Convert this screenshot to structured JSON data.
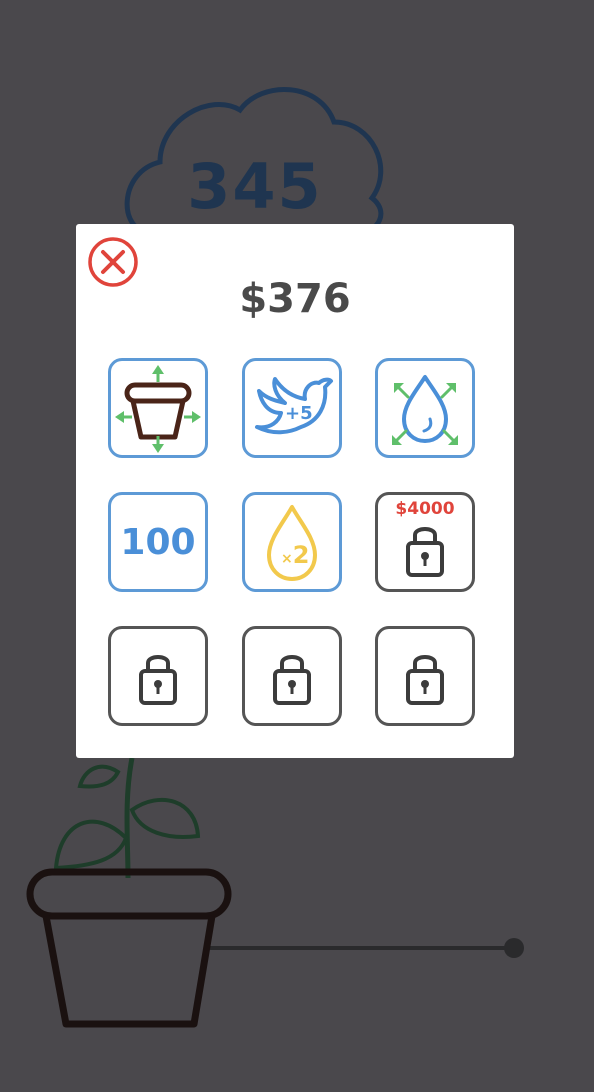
{
  "background": {
    "score": "345"
  },
  "shop": {
    "money": "$376",
    "tiles": [
      {
        "name": "pot-upgrade",
        "icon": "pot-expand-icon",
        "locked": false
      },
      {
        "name": "bird-bonus",
        "icon": "bird-icon",
        "label": "+5",
        "locked": false
      },
      {
        "name": "drop-upgrade",
        "icon": "drop-expand-icon",
        "locked": false
      },
      {
        "name": "hundred",
        "icon": "number-icon",
        "label": "100",
        "locked": false
      },
      {
        "name": "drop-x2",
        "icon": "drop-multiplier-icon",
        "label_x": "×",
        "label_2": "2",
        "locked": false
      },
      {
        "name": "locked-4000",
        "icon": "lock-icon",
        "price": "$4000",
        "locked": true
      },
      {
        "name": "locked-a",
        "icon": "lock-icon",
        "locked": true
      },
      {
        "name": "locked-b",
        "icon": "lock-icon",
        "locked": true
      },
      {
        "name": "locked-c",
        "icon": "lock-icon",
        "locked": true
      }
    ]
  },
  "colors": {
    "background": "#4a484c",
    "tile_border_blue": "#5d9ad6",
    "tile_border_gray": "#555555",
    "close_red": "#e0443b",
    "arrow_green": "#5fbf6a",
    "drop_yellow": "#f2c94c"
  }
}
